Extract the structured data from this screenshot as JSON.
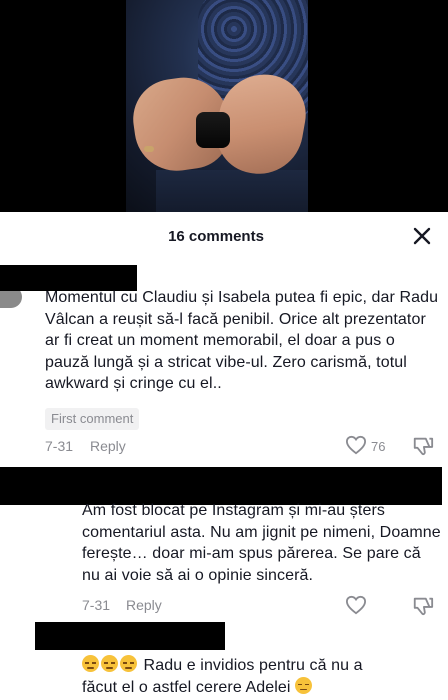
{
  "sheet": {
    "count_label": "16 comments"
  },
  "comments": [
    {
      "text": "Momentul cu Claudiu și Isabela putea fi epic, dar Radu Vâlcan a reușit să-l facă penibil. Orice alt prezentator ar fi creat un moment memorabil, el doar a pus o pauză lungă și a stricat vibe-ul. Zero carismă, totul awkward și cringe cu el..",
      "badge": "First comment",
      "date": "7-31",
      "reply_label": "Reply",
      "likes": "76"
    },
    {
      "text": "Am fost blocat pe Instagram și mi-au șters comentariul asta. Nu am jignit pe nimeni, Doamne ferește… doar mi-am spus părerea. Se pare că nu ai voie să ai o opinie sinceră.",
      "date": "7-31",
      "reply_label": "Reply"
    },
    {
      "text_prefix": "  Radu e invidios pentru că nu a",
      "text_line2": "făcut el o astfel cerere Adelei ",
      "emoji_name": "pensive-face-emoji"
    }
  ],
  "colors": {
    "text": "#161823",
    "meta": "#8a8b91",
    "badge_bg": "#f1f1f2",
    "redaction": "#000000"
  },
  "icons": {
    "close": "close-icon",
    "like": "heart-icon",
    "dislike": "dislike-icon"
  }
}
